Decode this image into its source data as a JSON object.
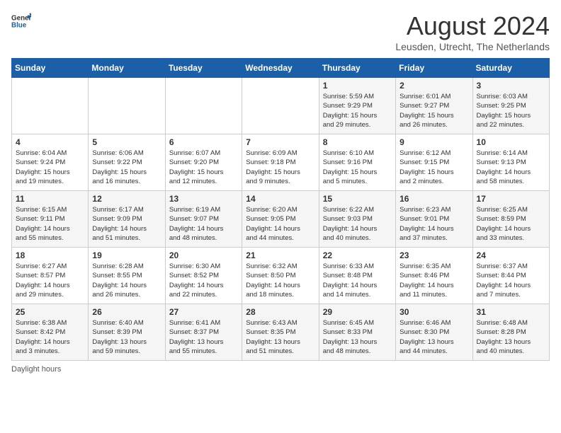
{
  "header": {
    "logo_general": "General",
    "logo_blue": "Blue",
    "month_title": "August 2024",
    "subtitle": "Leusden, Utrecht, The Netherlands"
  },
  "days_of_week": [
    "Sunday",
    "Monday",
    "Tuesday",
    "Wednesday",
    "Thursday",
    "Friday",
    "Saturday"
  ],
  "footer": {
    "daylight_label": "Daylight hours"
  },
  "weeks": [
    {
      "days": [
        {
          "num": "",
          "info": ""
        },
        {
          "num": "",
          "info": ""
        },
        {
          "num": "",
          "info": ""
        },
        {
          "num": "",
          "info": ""
        },
        {
          "num": "1",
          "info": "Sunrise: 5:59 AM\nSunset: 9:29 PM\nDaylight: 15 hours\nand 29 minutes."
        },
        {
          "num": "2",
          "info": "Sunrise: 6:01 AM\nSunset: 9:27 PM\nDaylight: 15 hours\nand 26 minutes."
        },
        {
          "num": "3",
          "info": "Sunrise: 6:03 AM\nSunset: 9:25 PM\nDaylight: 15 hours\nand 22 minutes."
        }
      ]
    },
    {
      "days": [
        {
          "num": "4",
          "info": "Sunrise: 6:04 AM\nSunset: 9:24 PM\nDaylight: 15 hours\nand 19 minutes."
        },
        {
          "num": "5",
          "info": "Sunrise: 6:06 AM\nSunset: 9:22 PM\nDaylight: 15 hours\nand 16 minutes."
        },
        {
          "num": "6",
          "info": "Sunrise: 6:07 AM\nSunset: 9:20 PM\nDaylight: 15 hours\nand 12 minutes."
        },
        {
          "num": "7",
          "info": "Sunrise: 6:09 AM\nSunset: 9:18 PM\nDaylight: 15 hours\nand 9 minutes."
        },
        {
          "num": "8",
          "info": "Sunrise: 6:10 AM\nSunset: 9:16 PM\nDaylight: 15 hours\nand 5 minutes."
        },
        {
          "num": "9",
          "info": "Sunrise: 6:12 AM\nSunset: 9:15 PM\nDaylight: 15 hours\nand 2 minutes."
        },
        {
          "num": "10",
          "info": "Sunrise: 6:14 AM\nSunset: 9:13 PM\nDaylight: 14 hours\nand 58 minutes."
        }
      ]
    },
    {
      "days": [
        {
          "num": "11",
          "info": "Sunrise: 6:15 AM\nSunset: 9:11 PM\nDaylight: 14 hours\nand 55 minutes."
        },
        {
          "num": "12",
          "info": "Sunrise: 6:17 AM\nSunset: 9:09 PM\nDaylight: 14 hours\nand 51 minutes."
        },
        {
          "num": "13",
          "info": "Sunrise: 6:19 AM\nSunset: 9:07 PM\nDaylight: 14 hours\nand 48 minutes."
        },
        {
          "num": "14",
          "info": "Sunrise: 6:20 AM\nSunset: 9:05 PM\nDaylight: 14 hours\nand 44 minutes."
        },
        {
          "num": "15",
          "info": "Sunrise: 6:22 AM\nSunset: 9:03 PM\nDaylight: 14 hours\nand 40 minutes."
        },
        {
          "num": "16",
          "info": "Sunrise: 6:23 AM\nSunset: 9:01 PM\nDaylight: 14 hours\nand 37 minutes."
        },
        {
          "num": "17",
          "info": "Sunrise: 6:25 AM\nSunset: 8:59 PM\nDaylight: 14 hours\nand 33 minutes."
        }
      ]
    },
    {
      "days": [
        {
          "num": "18",
          "info": "Sunrise: 6:27 AM\nSunset: 8:57 PM\nDaylight: 14 hours\nand 29 minutes."
        },
        {
          "num": "19",
          "info": "Sunrise: 6:28 AM\nSunset: 8:55 PM\nDaylight: 14 hours\nand 26 minutes."
        },
        {
          "num": "20",
          "info": "Sunrise: 6:30 AM\nSunset: 8:52 PM\nDaylight: 14 hours\nand 22 minutes."
        },
        {
          "num": "21",
          "info": "Sunrise: 6:32 AM\nSunset: 8:50 PM\nDaylight: 14 hours\nand 18 minutes."
        },
        {
          "num": "22",
          "info": "Sunrise: 6:33 AM\nSunset: 8:48 PM\nDaylight: 14 hours\nand 14 minutes."
        },
        {
          "num": "23",
          "info": "Sunrise: 6:35 AM\nSunset: 8:46 PM\nDaylight: 14 hours\nand 11 minutes."
        },
        {
          "num": "24",
          "info": "Sunrise: 6:37 AM\nSunset: 8:44 PM\nDaylight: 14 hours\nand 7 minutes."
        }
      ]
    },
    {
      "days": [
        {
          "num": "25",
          "info": "Sunrise: 6:38 AM\nSunset: 8:42 PM\nDaylight: 14 hours\nand 3 minutes."
        },
        {
          "num": "26",
          "info": "Sunrise: 6:40 AM\nSunset: 8:39 PM\nDaylight: 13 hours\nand 59 minutes."
        },
        {
          "num": "27",
          "info": "Sunrise: 6:41 AM\nSunset: 8:37 PM\nDaylight: 13 hours\nand 55 minutes."
        },
        {
          "num": "28",
          "info": "Sunrise: 6:43 AM\nSunset: 8:35 PM\nDaylight: 13 hours\nand 51 minutes."
        },
        {
          "num": "29",
          "info": "Sunrise: 6:45 AM\nSunset: 8:33 PM\nDaylight: 13 hours\nand 48 minutes."
        },
        {
          "num": "30",
          "info": "Sunrise: 6:46 AM\nSunset: 8:30 PM\nDaylight: 13 hours\nand 44 minutes."
        },
        {
          "num": "31",
          "info": "Sunrise: 6:48 AM\nSunset: 8:28 PM\nDaylight: 13 hours\nand 40 minutes."
        }
      ]
    }
  ]
}
